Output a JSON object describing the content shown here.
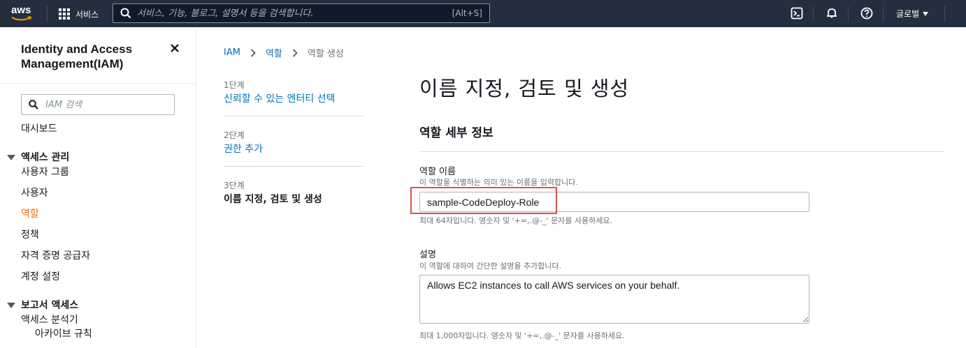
{
  "topnav": {
    "logo_text": "aws",
    "services_label": "서비스",
    "search_placeholder": "서비스, 기능, 블로그, 설명서 등을 검색합니다.",
    "search_shortcut": "[Alt+S]",
    "region_label": "글로벌",
    "icons": [
      "cloudshell-icon",
      "bell-icon",
      "help-icon"
    ]
  },
  "sidebar": {
    "title": "Identity and Access Management(IAM)",
    "search_placeholder": "IAM 검색",
    "dashboard": "대시보드",
    "access_mgmt_header": "액세스 관리",
    "access_mgmt_items": [
      "사용자 그룹",
      "사용자",
      "역할",
      "정책",
      "자격 증명 공급자",
      "계정 설정"
    ],
    "active_item": "역할",
    "report_header": "보고서 액세스",
    "report_items": [
      "액세스 분석기",
      "아카이브 규칙"
    ]
  },
  "breadcrumb": {
    "items": [
      "IAM",
      "역할",
      "역할 생성"
    ]
  },
  "steps": [
    {
      "label": "1단계",
      "title": "신뢰할 수 있는 엔터티 선택"
    },
    {
      "label": "2단계",
      "title": "권한 추가"
    },
    {
      "label": "3단계",
      "title": "이름 지정, 검토 및 생성"
    }
  ],
  "main": {
    "title": "이름 지정, 검토 및 생성",
    "section_title": "역할 세부 정보",
    "role_name_label": "역할 이름",
    "role_name_desc": "이 역할을 식별하는 의미 있는 이름을 입력합니다.",
    "role_name_value": "sample-CodeDeploy-Role",
    "role_name_hint": "최대 64자입니다. 영숫자 및 '+=,.@-_' 문자를 사용하세요.",
    "description_label": "설명",
    "description_desc": "이 역할에 대하여 간단한 설명을 추가합니다.",
    "description_value": "Allows EC2 instances to call AWS services on your behalf.",
    "description_hint": "최대 1,000자입니다. 영숫자 및 '+=,.@-_' 문자를 사용하세요."
  },
  "colors": {
    "nav_bg": "#232f3e",
    "link": "#0073bb",
    "active": "#ec7211",
    "highlight": "#d9534f"
  }
}
